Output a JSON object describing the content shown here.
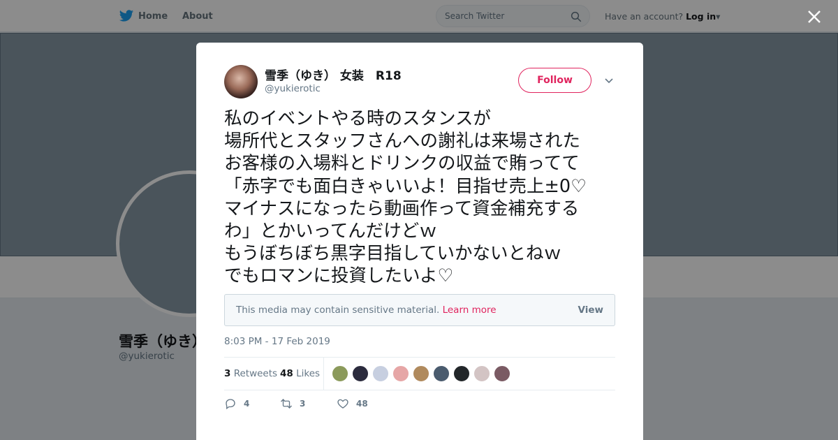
{
  "nav": {
    "home_label": "Home",
    "about_label": "About",
    "search_placeholder": "Search Twitter",
    "account_prompt": "Have an account?",
    "login_label": "Log in"
  },
  "profile": {
    "name": "雪季（ゆき）",
    "handle": "@yukierotic"
  },
  "tweet": {
    "author_name": "雪季（ゆき） 女装　R18",
    "author_handle": "@yukierotic",
    "follow_label": "Follow",
    "text_lines": [
      "私のイベントやる時のスタンスが",
      "場所代とスタッフさんへの謝礼は来場された",
      "お客様の入場料とドリンクの収益で賄ってて",
      "「赤字でも面白きゃいいよ！目指せ売上±0♡",
      "マイナスになったら動画作って資金補充する",
      "わ」とかいってんだけどｗ",
      "もうぼちぼち黒字目指していかないとねｗ",
      "でもロマンに投資したいよ♡"
    ],
    "sensitive_message": "This media may contain sensitive material.",
    "sensitive_learn_more": "Learn more",
    "sensitive_view": "View",
    "timestamp": "8:03 PM - 17 Feb 2019",
    "retweets_count": "3",
    "retweets_label": "Retweets",
    "likes_count": "48",
    "likes_label": "Likes",
    "reply_count": "4",
    "retweet_action_count": "3",
    "like_action_count": "48"
  },
  "colors": {
    "accent": "#e0245e",
    "twitter_blue": "#1da1f2",
    "text_secondary": "#657786"
  },
  "icons": [
    "twitter-bird-icon",
    "search-icon",
    "close-icon",
    "chevron-down-icon",
    "reply-icon",
    "retweet-icon",
    "heart-icon"
  ]
}
